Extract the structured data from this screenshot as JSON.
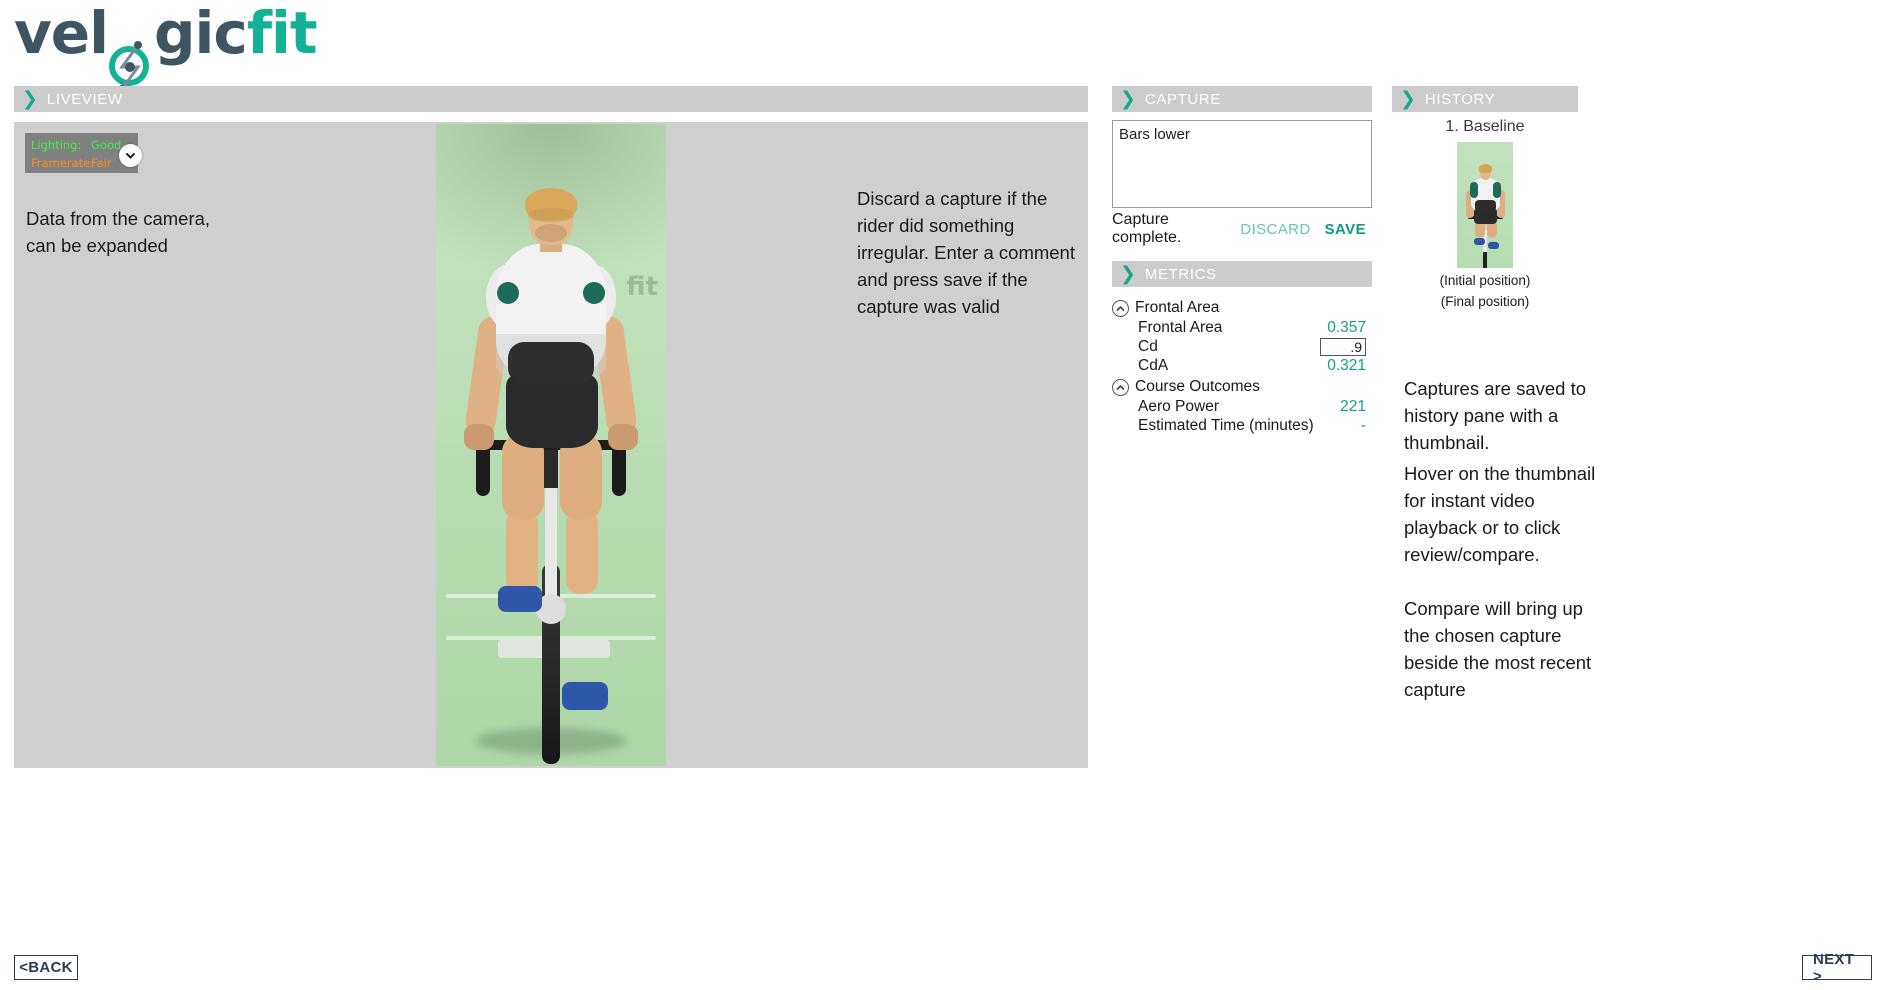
{
  "brand": {
    "name_part1": "vel",
    "name_part2": "gic",
    "name_part3": "fit",
    "color_dark": "#3f5662",
    "color_teal": "#15b196"
  },
  "liveview": {
    "header": "LIVEVIEW",
    "chevron": "❯",
    "camera_status": {
      "lighting_label": "Lighting:",
      "lighting_value": "Good",
      "lighting_color": "#3ff03f",
      "framerate_label": "Framerate:",
      "framerate_value": "Fair",
      "framerate_color": "#ff8a1e",
      "expand_icon": "chevron-down-icon"
    },
    "annotation_camera": "Data from the camera,\ncan be expanded",
    "annotation_capture": "Discard a capture if the rider did something irregular. Enter a comment and press save if the capture was valid",
    "video_watermark": "fit"
  },
  "capture": {
    "header": "CAPTURE",
    "chevron": "❯",
    "note_value": "Bars lower",
    "note_placeholder": "",
    "status": "Capture complete.",
    "discard_label": "DISCARD",
    "save_label": "SAVE",
    "discard_color": "#67c5b2",
    "save_color": "#0f9b80"
  },
  "metrics": {
    "header": "METRICS",
    "chevron": "❯",
    "value_color": "#12a189",
    "groups": [
      {
        "name": "Frontal Area",
        "collapse_icon": "chevron-up-icon",
        "rows": [
          {
            "label": "Frontal Area",
            "value": "0.357",
            "editable": false
          },
          {
            "label": "Cd",
            "value": ".9",
            "editable": true
          },
          {
            "label": "CdA",
            "value": "0.321",
            "editable": false
          }
        ]
      },
      {
        "name": "Course Outcomes",
        "collapse_icon": "chevron-up-icon",
        "rows": [
          {
            "label": "Aero Power",
            "value": "221",
            "editable": false
          },
          {
            "label": "Estimated Time (minutes)",
            "value": "-",
            "editable": false
          }
        ]
      }
    ]
  },
  "history": {
    "header": "HISTORY",
    "chevron": "❯",
    "entry_title": "1. Baseline",
    "caption_initial": "(Initial position)",
    "caption_final": "(Final position)",
    "annotation_1": "Captures are saved to history pane with a thumbnail.",
    "annotation_2": "Hover on the thumbnail for instant video playback or to click review/compare.",
    "annotation_3": "Compare will bring up the chosen capture beside the most recent capture"
  },
  "footer": {
    "back_label": "<BACK",
    "next_label": "NEXT >"
  }
}
